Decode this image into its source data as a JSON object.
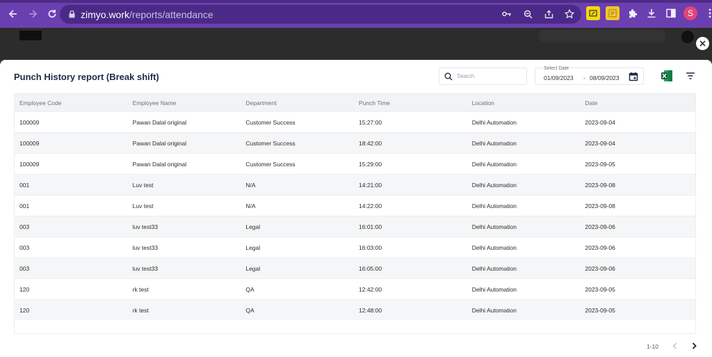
{
  "browser": {
    "url_host": "zimyo.work",
    "url_path": "/reports/attendance",
    "profile_initial": "S"
  },
  "modal": {
    "title": "Punch History report (Break shift)",
    "search_placeholder": "Search",
    "date_label": "Select Date",
    "date_from": "01/09/2023",
    "date_separator": "-",
    "date_to": "08/09/2023"
  },
  "table": {
    "columns": [
      "Employee Code",
      "Employee Name",
      "Department",
      "Punch Time",
      "Location",
      "Date"
    ],
    "rows": [
      [
        "100009",
        "Pawan Dalal original",
        "Customer Success",
        "15:27:00",
        "Delhi Automation",
        "2023-09-04"
      ],
      [
        "100009",
        "Pawan Dalal original",
        "Customer Success",
        "18:42:00",
        "Delhi Automation",
        "2023-09-04"
      ],
      [
        "100009",
        "Pawan Dalal original",
        "Customer Success",
        "15:29:00",
        "Delhi Automation",
        "2023-09-05"
      ],
      [
        "001",
        "Luv test",
        "N/A",
        "14:21:00",
        "Delhi Automation",
        "2023-09-08"
      ],
      [
        "001",
        "Luv test",
        "N/A",
        "14:22:00",
        "Delhi Automation",
        "2023-09-08"
      ],
      [
        "003",
        "luv test33",
        "Legal",
        "16:01:00",
        "Delhi Automation",
        "2023-09-06"
      ],
      [
        "003",
        "luv test33",
        "Legal",
        "16:03:00",
        "Delhi Automation",
        "2023-09-06"
      ],
      [
        "003",
        "luv test33",
        "Legal",
        "16:05:00",
        "Delhi Automation",
        "2023-09-06"
      ],
      [
        "120",
        "rk test",
        "QA",
        "12:42:00",
        "Delhi Automation",
        "2023-09-05"
      ],
      [
        "120",
        "rk test",
        "QA",
        "12:48:00",
        "Delhi Automation",
        "2023-09-05"
      ]
    ]
  },
  "pagination": {
    "range": "1-10"
  },
  "colors": {
    "browser_chrome": "#6a3fb0",
    "modal_bg": "#ffffff",
    "row_alt": "#f5f6f7",
    "excel_green": "#1e7145"
  },
  "icons": [
    "back-icon",
    "forward-icon",
    "reload-icon",
    "lock-icon",
    "key-icon",
    "zoom-icon",
    "share-icon",
    "star-icon",
    "extension-icon",
    "download-icon",
    "sidebar-icon",
    "more-icon",
    "close-icon",
    "search-icon",
    "calendar-icon",
    "excel-icon",
    "filter-icon",
    "chevron-left-icon",
    "chevron-right-icon"
  ]
}
